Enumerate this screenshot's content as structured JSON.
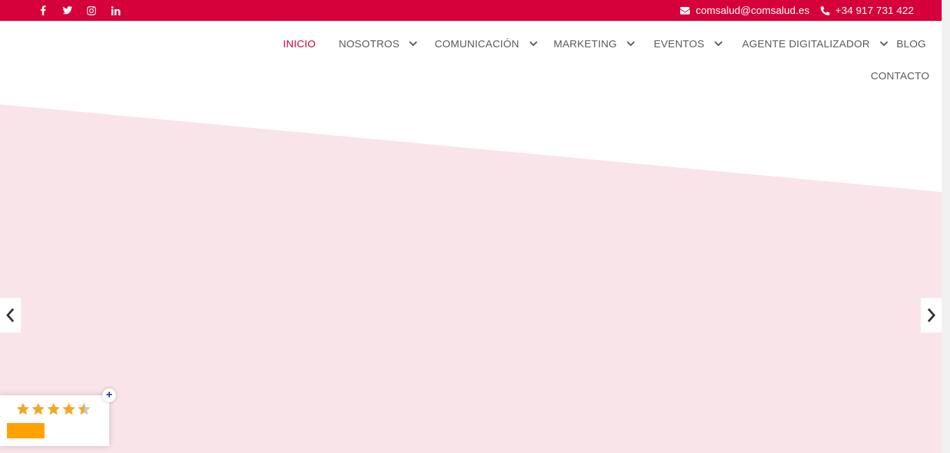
{
  "topbar": {
    "email": "comsalud@comsalud.es",
    "phone": "+34 917 731 422",
    "social": [
      "facebook-icon",
      "twitter-icon",
      "instagram-icon",
      "linkedin-icon"
    ]
  },
  "nav": {
    "items": [
      {
        "label": "INICIO",
        "active": true,
        "dropdown": false
      },
      {
        "label": "NOSOTROS",
        "active": false,
        "dropdown": true
      },
      {
        "label": "COMUNICACIÓN",
        "active": false,
        "dropdown": true
      },
      {
        "label": "MARKETING",
        "active": false,
        "dropdown": true
      },
      {
        "label": "EVENTOS",
        "active": false,
        "dropdown": true
      },
      {
        "label": "AGENTE DIGITALIZADOR",
        "active": false,
        "dropdown": true
      },
      {
        "label": "BLOG",
        "active": false,
        "dropdown": false
      },
      {
        "label": "CONTACTO",
        "active": false,
        "dropdown": false
      }
    ]
  },
  "colors": {
    "brand": "#d6003a",
    "hero_bg": "#f8e4e9",
    "star": "#f5a623",
    "rating_bar": "#ffa200"
  },
  "rating": {
    "stars": 4.5,
    "max": 5,
    "expand_label": "+"
  },
  "slider": {
    "prev_icon": "chevron-left-icon",
    "next_icon": "chevron-right-icon"
  }
}
